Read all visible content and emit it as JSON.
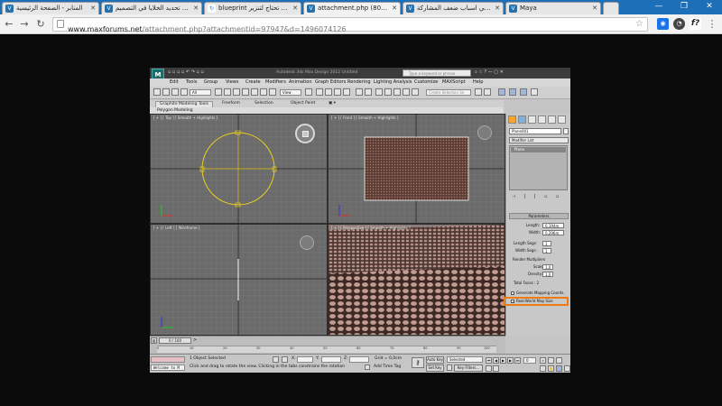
{
  "browser": {
    "tabs": [
      {
        "title": "المنابر - الصفحة الرئيسية",
        "favicon_color": "#2a6fa6"
      },
      {
        "title": "كيفية تحديد الخلايا في التصميم",
        "favicon_color": "#2a6fa6"
      },
      {
        "title": "blueprint سؤال تحتاج لتنزير -",
        "favicon_color": "#1a73e8"
      },
      {
        "title": "attachment.php (800×450)",
        "favicon_color": "#2a6fa6"
      },
      {
        "title": "ما هي اسباب ضعف المشاركة",
        "favicon_color": "#2a6fa6"
      },
      {
        "title": "Maya",
        "favicon_color": "#2a6fa6"
      }
    ],
    "active_tab_index": 3,
    "url_host": "www.maxforums.net",
    "url_path": "/attachment.php?attachmentid=97947&d=1496074126",
    "accent_color": "#1d6fb8"
  },
  "max": {
    "title": "Autodesk 3ds Max Design 2012  Untitled",
    "search_placeholder": "Type a keyword or phrase",
    "menu": [
      "Edit",
      "Tools",
      "Group",
      "Views",
      "Create",
      "Modifiers",
      "Animation",
      "Graph Editors",
      "Rendering",
      "Lighting Analysis",
      "Customize",
      "MAXScript",
      "Help"
    ],
    "toolbar": {
      "filter": "All",
      "ref_coord": "View",
      "selection_set": "Create Selection Se"
    },
    "ribbon_tabs": [
      "Graphite Modeling Tools",
      "Freeform",
      "Selection",
      "Object Paint"
    ],
    "ribbon_sub": "Polygon Modeling",
    "viewports": [
      {
        "label": "[ + ] [ Top ] [ Smooth + Highlights ]"
      },
      {
        "label": "[ + ] [ Front ] [ Smooth + Highlights ]"
      },
      {
        "label": "[ + ] [ Left ] [ Wireframe ]"
      },
      {
        "label": "[ + ] [ Perspective ] [ Smooth + Highlights ]"
      }
    ],
    "command_panel": {
      "object_name": "Plane001",
      "modifier_list": "Modifier List",
      "stack_item": "Plane",
      "rollout": "Parameters",
      "length_label": "Length:",
      "length_value": "0,194m",
      "width_label": "Width:",
      "width_value": "0,296m",
      "length_segs_label": "Length Segs:",
      "length_segs_value": "1",
      "width_segs_label": "Width Segs:",
      "width_segs_value": "1",
      "render_mult_label": "Render Multipliers",
      "scale_label": "Scale:",
      "scale_value": "1,0",
      "density_label": "Density:",
      "density_value": "1,0",
      "total_faces": "Total Faces : 2",
      "gen_map_coords": "Generate Mapping Coords.",
      "real_world_map": "Real-World Map Size"
    },
    "timeline": {
      "frame_display": "0 / 100",
      "ticks": [
        "0",
        "10",
        "20",
        "30",
        "40",
        "50",
        "60",
        "70",
        "80",
        "90",
        "100"
      ]
    },
    "status": {
      "welcome": "Welcome to M",
      "selected": "1 Object Selected",
      "prompt": "Click and drag to rotate the view.  Clicking in the tabs constrains the rotation",
      "x_label": "X:",
      "y_label": "Y:",
      "z_label": "Z:",
      "grid": "Grid = 0,0cm",
      "add_time_tag": "Add Time Tag",
      "auto_key": "Auto Key",
      "selected_dd": "Selected",
      "set_key": "Set Key",
      "key_filters": "Key Filters...",
      "frame": "0"
    }
  }
}
